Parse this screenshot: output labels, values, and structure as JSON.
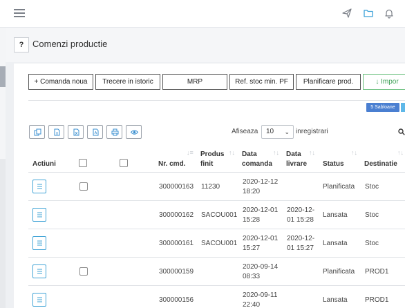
{
  "topbar": {
    "icons": [
      "menu-icon",
      "send-icon",
      "folder-icon",
      "bell-icon"
    ]
  },
  "page": {
    "help": "?",
    "title": "Comenzi productie"
  },
  "toolbar": {
    "buttons": [
      "+ Comanda noua",
      "Trecere in istoric",
      "MRP",
      "Ref. stoc min. PF",
      "Planificare prod.",
      "↓ Impor"
    ]
  },
  "sabloane": "5 Sabloane",
  "export_icons": [
    "copy-icon",
    "csv-icon",
    "excel-icon",
    "pdf-icon",
    "print-icon",
    "eye-icon"
  ],
  "pagination": {
    "show_label": "Afiseaza",
    "page_size": "10",
    "records_label": "inregistrari"
  },
  "table": {
    "headers": {
      "actions": "Actiuni",
      "nr_cmd": "Nr. cmd.",
      "produs_1": "Produs",
      "produs_2": "finit",
      "data_cmd_1": "Data",
      "data_cmd_2": "comanda",
      "data_livr_1": "Data",
      "data_livr_2": "livrare",
      "status": "Status",
      "destinatie": "Destinatie"
    },
    "rows": [
      {
        "nr": "300000163",
        "produs": "11230",
        "dc1": "2020-12-12",
        "dc2": "18:20",
        "dl1": "",
        "dl2": "",
        "status": "Planificata",
        "dest": "Stoc"
      },
      {
        "nr": "300000162",
        "produs": "SACOU001",
        "dc1": "2020-12-01",
        "dc2": "15:28",
        "dl1": "2020-12-",
        "dl2": "01 15:28",
        "status": "Lansata",
        "dest": "Stoc"
      },
      {
        "nr": "300000161",
        "produs": "SACOU001",
        "dc1": "2020-12-01",
        "dc2": "15:27",
        "dl1": "2020-12-",
        "dl2": "01 15:27",
        "status": "Lansata",
        "dest": "Stoc"
      },
      {
        "nr": "300000159",
        "produs": "",
        "dc1": "2020-09-14",
        "dc2": "08:33",
        "dl1": "",
        "dl2": "",
        "status": "Planificata",
        "dest": "PROD1"
      },
      {
        "nr": "300000156",
        "produs": "",
        "dc1": "2020-09-11",
        "dc2": "22:40",
        "dl1": "",
        "dl2": "",
        "status": "Lansata",
        "dest": "PROD1"
      }
    ]
  }
}
